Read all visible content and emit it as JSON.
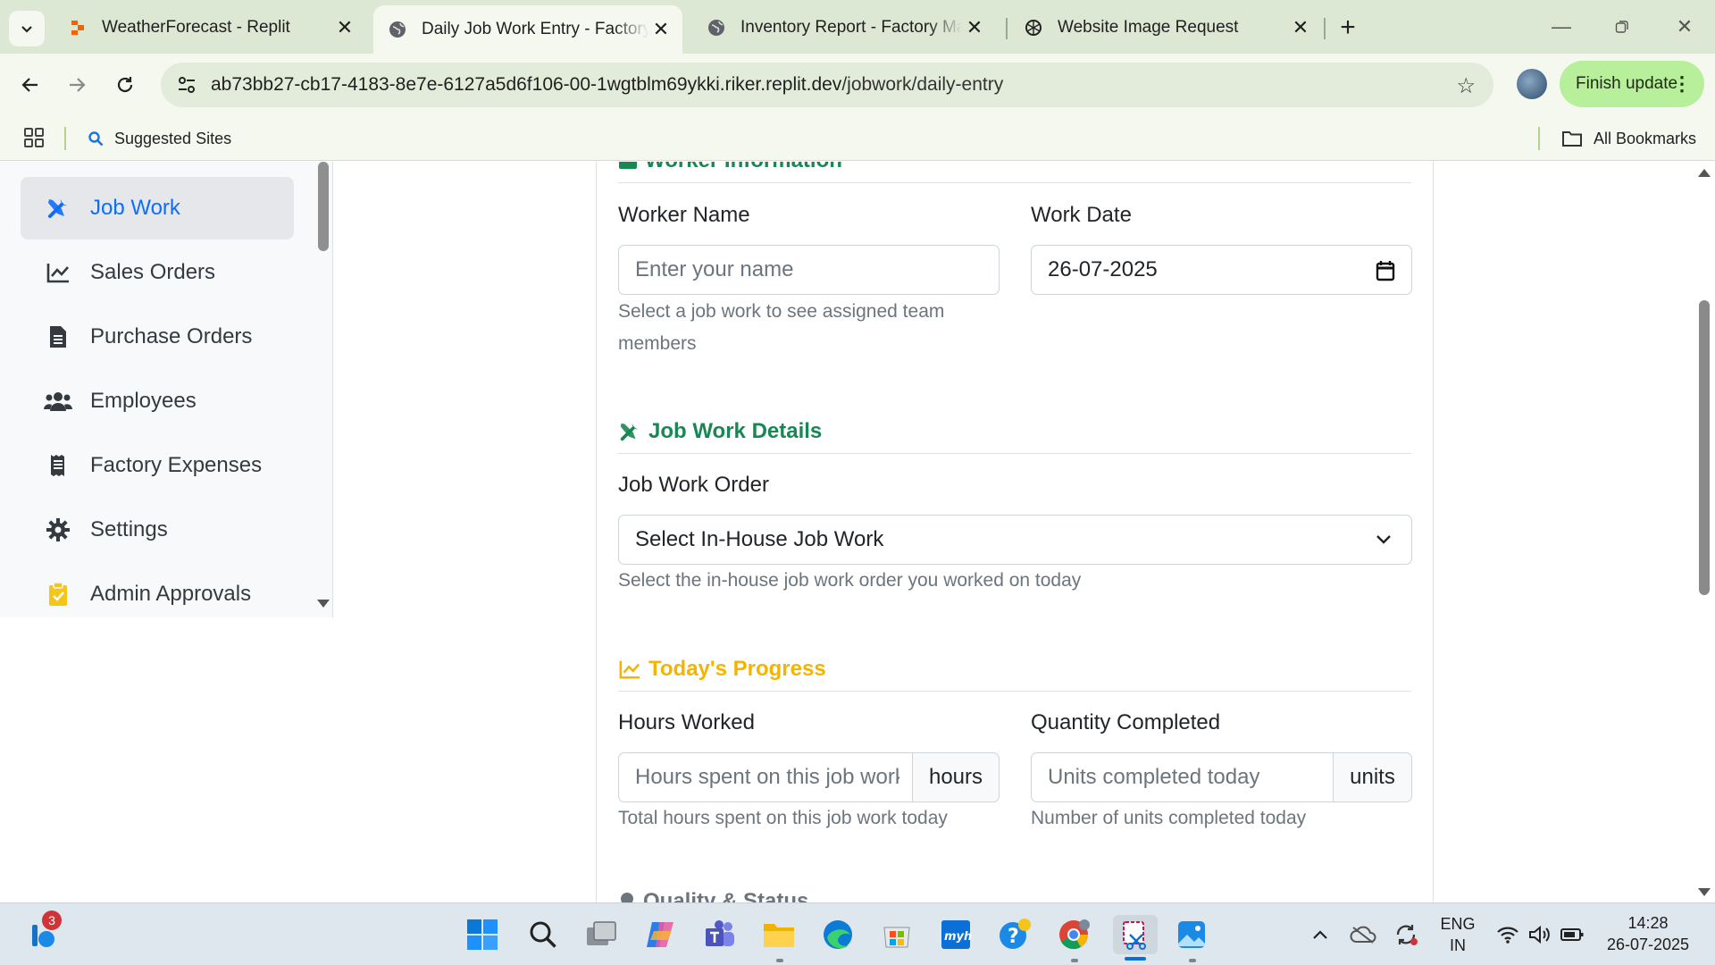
{
  "browser": {
    "tabs": [
      {
        "title": "WeatherForecast - Replit",
        "favicon": "replit-icon"
      },
      {
        "title": "Daily Job Work Entry - Factory M",
        "favicon": "globe-icon",
        "active": true
      },
      {
        "title": "Inventory Report - Factory Man",
        "favicon": "globe-icon"
      },
      {
        "title": "Website Image Request",
        "favicon": "openai-icon"
      }
    ],
    "url_host": "ab73bb27-cb17-4183-8e7e-6127a5d6f106-00-1wgtblm69ykki.riker.replit.dev",
    "url_path": "/jobwork/daily-entry",
    "finish_update_label": "Finish update",
    "bookmarks": {
      "suggested_sites": "Suggested Sites",
      "all_bookmarks": "All Bookmarks"
    }
  },
  "sidebar": {
    "items": [
      {
        "label": "Job Work",
        "icon": "tools-icon",
        "active": true
      },
      {
        "label": "Sales Orders",
        "icon": "chart-line-icon"
      },
      {
        "label": "Purchase Orders",
        "icon": "file-invoice-icon"
      },
      {
        "label": "Employees",
        "icon": "users-icon"
      },
      {
        "label": "Factory Expenses",
        "icon": "receipt-icon"
      },
      {
        "label": "Settings",
        "icon": "gear-icon"
      },
      {
        "label": "Admin Approvals",
        "icon": "clipboard-check-icon"
      }
    ]
  },
  "form": {
    "worker_section_title": "Worker Information",
    "worker_name_label": "Worker Name",
    "worker_name_placeholder": "Enter your name",
    "worker_name_help": "Select a job work to see assigned team members",
    "work_date_label": "Work Date",
    "work_date_value": "26-07-2025",
    "job_section_title": "Job Work Details",
    "job_order_label": "Job Work Order",
    "job_order_selected": "Select In-House Job Work",
    "job_order_help": "Select the in-house job work order you worked on today",
    "progress_section_title": "Today's Progress",
    "hours_label": "Hours Worked",
    "hours_placeholder": "Hours spent on this job work",
    "hours_unit": "hours",
    "hours_help": "Total hours spent on this job work today",
    "qty_label": "Quantity Completed",
    "qty_placeholder": "Units completed today",
    "qty_unit": "units",
    "qty_help": "Number of units completed today",
    "quality_section_title": "Quality & Status"
  },
  "taskbar": {
    "widget_badge": "3",
    "lang_line1": "ENG",
    "lang_line2": "IN",
    "time": "14:28",
    "date": "26-07-2025"
  },
  "colors": {
    "accent_blue": "#0d6efd",
    "section_green": "#198754",
    "section_yellow": "#f4b400",
    "finish_update_bg": "#b7ef9a"
  }
}
